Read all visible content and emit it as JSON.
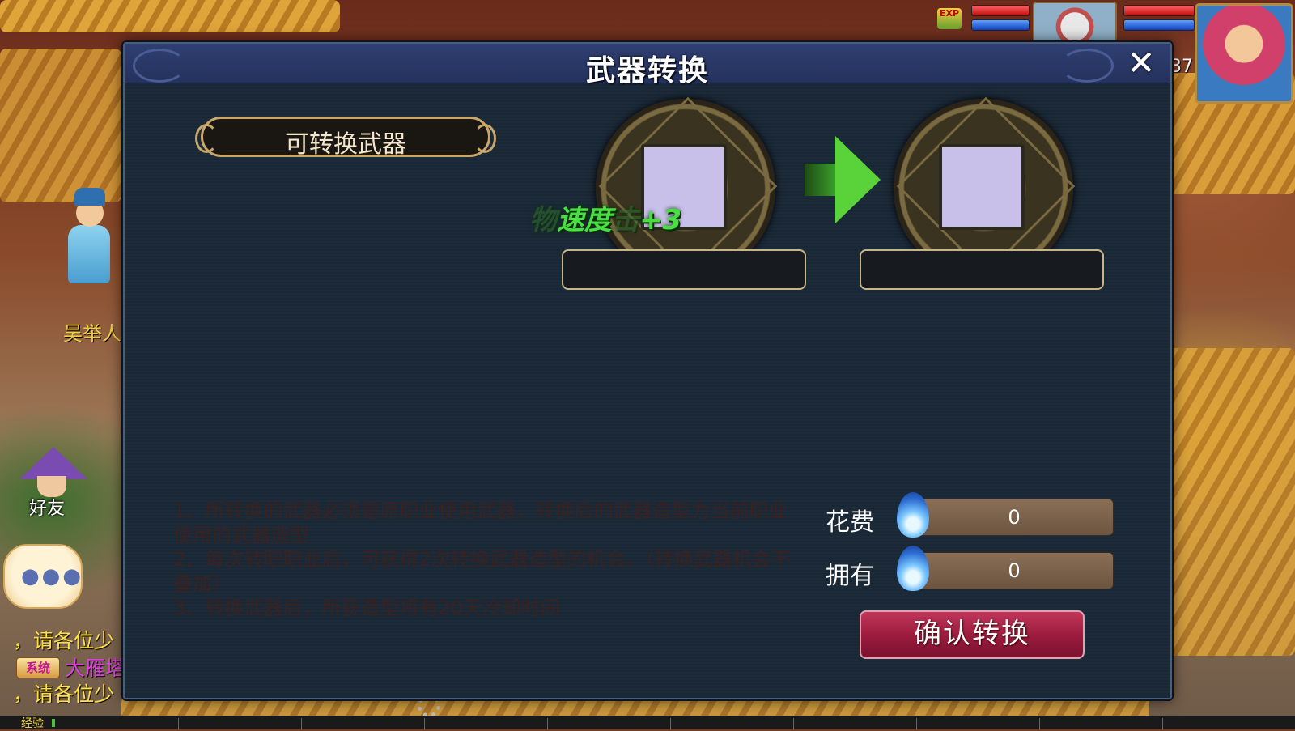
{
  "dialog": {
    "title": "武器转换",
    "close_symbol": "✕",
    "list_header": "可转换武器",
    "float_effect": {
      "ghost_prefix": "物",
      "stat": "速度",
      "ghost_mid": "击",
      "bonus": "+3"
    },
    "source_slot": {
      "name": ""
    },
    "target_slot": {
      "name": ""
    },
    "notes": [
      "1、所转换的武器必须是原职业使用武器，转换后的武器造型为当前职业使用的武器造型",
      "2、每次转职职业后，可获得2次转换武器造型的机会。（转换武器机会不叠加）",
      "3、转换武器后，所获造型将有20天冷却时间"
    ],
    "cost": {
      "label": "花费",
      "value": "0"
    },
    "owned": {
      "label": "拥有",
      "value": "0"
    },
    "confirm_label": "确认转换"
  },
  "world": {
    "npc_name": "吴举人",
    "friend_label": "好友",
    "chat_lines": [
      {
        "text": "，请各位少",
        "color": "#ffe040"
      },
      {
        "system": "系统",
        "text": "大雁塔",
        "color": "#e040e0"
      },
      {
        "text": "，请各位少",
        "color": "#ffe040"
      }
    ],
    "exp_label": "经验",
    "exp_icon": "EXP",
    "level_fragment": "37"
  },
  "colors": {
    "accent_green": "#48e040",
    "confirm_red": "#9a1a3c",
    "panel": "#1c2b3a"
  }
}
